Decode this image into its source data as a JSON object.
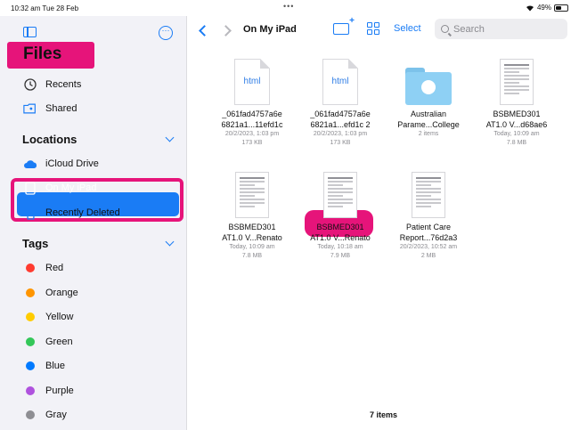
{
  "status": {
    "time": "10:32 am  Tue 28 Feb",
    "dots": "•••",
    "wifi": "wifi-icon",
    "battery": "49%",
    "battery_level": 0.49
  },
  "sidebar": {
    "title": "Files",
    "items_top": [
      {
        "label": "Recents",
        "icon": "clock-icon"
      },
      {
        "label": "Shared",
        "icon": "shared-folder-icon"
      }
    ],
    "locations_header": "Locations",
    "locations": [
      {
        "label": "iCloud Drive",
        "icon": "cloud-icon"
      },
      {
        "label": "On My iPad",
        "icon": "ipad-icon",
        "selected": true
      },
      {
        "label": "Recently Deleted",
        "icon": "trash-icon"
      }
    ],
    "tags_header": "Tags",
    "tags": [
      {
        "label": "Red",
        "color": "#ff3b30"
      },
      {
        "label": "Orange",
        "color": "#ff9500"
      },
      {
        "label": "Yellow",
        "color": "#ffcc00"
      },
      {
        "label": "Green",
        "color": "#34c759"
      },
      {
        "label": "Blue",
        "color": "#007aff"
      },
      {
        "label": "Purple",
        "color": "#af52de"
      },
      {
        "label": "Gray",
        "color": "#8e8e93"
      }
    ]
  },
  "toolbar": {
    "title": "On My iPad",
    "select": "Select",
    "search_placeholder": "Search"
  },
  "files": [
    {
      "type": "html",
      "thumb_label": "html",
      "line1": "_061fad4757a6e",
      "line2": "6821a1...11efd1c",
      "date": "20/2/2023, 1:03 pm",
      "size": "173 KB"
    },
    {
      "type": "html",
      "thumb_label": "html",
      "line1": "_061fad4757a6e",
      "line2": "6821a1...efd1c 2",
      "date": "20/2/2023, 1:03 pm",
      "size": "173 KB"
    },
    {
      "type": "folder",
      "line1": "Australian",
      "line2": "Parame...College",
      "date": "2 items",
      "size": ""
    },
    {
      "type": "pdf",
      "line1": "BSBMED301",
      "line2": "AT1.0 V...d68ae6",
      "date": "Today, 10:09 am",
      "size": "7.8 MB"
    },
    {
      "type": "pdf",
      "line1": "BSBMED301",
      "line2": "AT1.0 V...Renato",
      "date": "Today, 10:09 am",
      "size": "7.8 MB"
    },
    {
      "type": "pdf",
      "line1": "BSBMED301",
      "line2": "AT1.0 V...Renato",
      "date": "Today, 10:18 am",
      "size": "7.9 MB"
    },
    {
      "type": "pdf",
      "line1": "Patient Care",
      "line2": "Report...76d2a3",
      "date": "20/2/2023, 10:52 am",
      "size": "2 MB"
    }
  ],
  "footer": "7 items",
  "colors": {
    "accent": "#1a7cf5",
    "annotation": "#e6147a"
  }
}
